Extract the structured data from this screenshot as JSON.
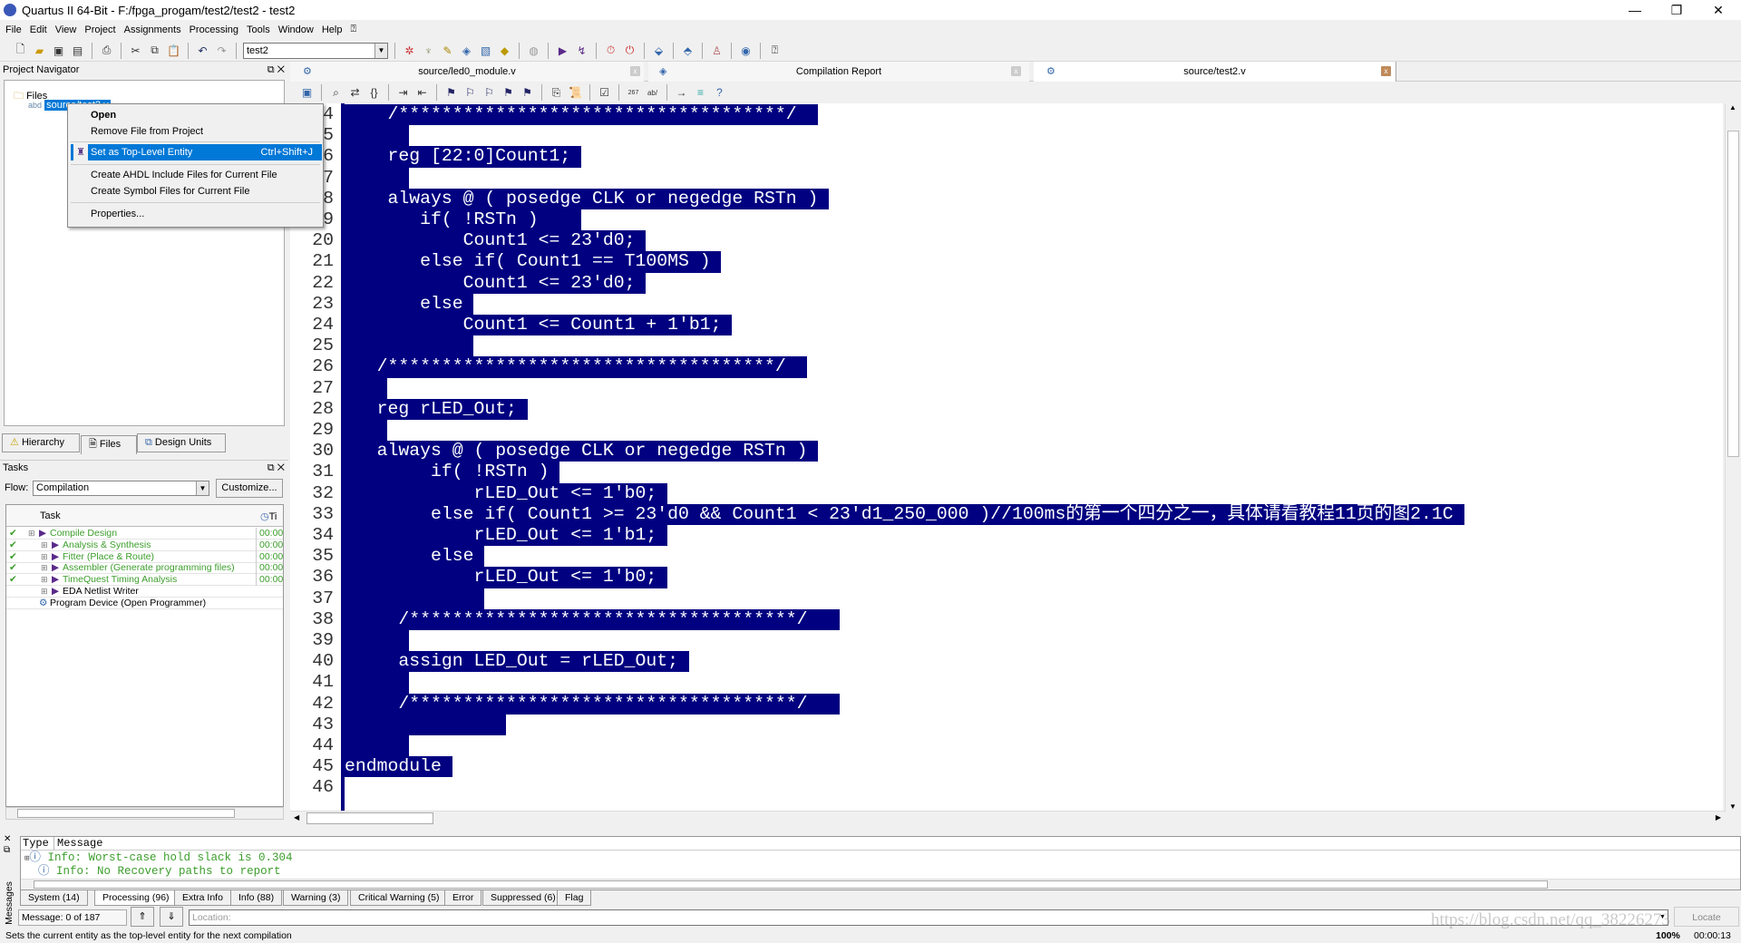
{
  "window": {
    "title": "Quartus II 64-Bit - F:/fpga_progam/test2/test2 - test2",
    "minimize": "—",
    "restore": "❐",
    "close": "✕"
  },
  "menu": [
    "File",
    "Edit",
    "View",
    "Project",
    "Assignments",
    "Processing",
    "Tools",
    "Window",
    "Help"
  ],
  "toolbar": {
    "project_select": "test2",
    "icons": [
      "new-file-icon",
      "open-icon",
      "save-icon",
      "save-all-icon",
      "print-icon",
      "cut-icon",
      "copy-icon",
      "paste-icon",
      "undo-icon",
      "redo-icon"
    ],
    "right_icons": [
      "compile-icon",
      "analysis-icon",
      "pencil-icon",
      "synthesis-icon",
      "fitter-icon",
      "assembler-icon",
      "netlist-icon",
      "start-icon",
      "timing-icon",
      "stopwatch-icon",
      "stop-icon",
      "chip-planner-icon",
      "rtl-viewer-icon",
      "programmer-icon",
      "help-icon",
      "whats-this-icon"
    ]
  },
  "navigator": {
    "title": "Project Navigator",
    "root": "Files",
    "file": "source/test2.v",
    "tabs": [
      "Hierarchy",
      "Files",
      "Design Units"
    ]
  },
  "context_menu": {
    "items": [
      "Open",
      "Remove File from Project",
      "Set as Top-Level Entity",
      "Create AHDL Include Files for Current File",
      "Create Symbol Files for Current File",
      "Properties..."
    ],
    "shortcut": "Ctrl+Shift+J"
  },
  "tasks": {
    "title": "Tasks",
    "flow_label": "Flow:",
    "flow_value": "Compilation",
    "customize": "Customize...",
    "col_task": "Task",
    "col_time": "Ti",
    "rows": [
      {
        "done": true,
        "name": "Compile Design",
        "time": "00:00",
        "level": 0
      },
      {
        "done": true,
        "name": "Analysis & Synthesis",
        "time": "00:00",
        "level": 1
      },
      {
        "done": true,
        "name": "Fitter (Place & Route)",
        "time": "00:00",
        "level": 1
      },
      {
        "done": true,
        "name": "Assembler (Generate programming files)",
        "time": "00:00",
        "level": 1
      },
      {
        "done": true,
        "name": "TimeQuest Timing Analysis",
        "time": "00:00",
        "level": 1
      },
      {
        "done": false,
        "name": "EDA Netlist Writer",
        "time": "",
        "level": 1
      },
      {
        "done": false,
        "name": "Program Device (Open Programmer)",
        "time": "",
        "level": 0
      }
    ]
  },
  "editor": {
    "tabs": [
      "source/led0_module.v",
      "Compilation Report",
      "source/test2.v"
    ],
    "first_line": 14,
    "lines": [
      "    /************************************/  ",
      "      ",
      "    reg [22:0]Count1; ",
      "      ",
      "    always @ ( posedge CLK or negedge RSTn ) ",
      "       if( !RSTn )    ",
      "           Count1 <= 23'd0; ",
      "       else if( Count1 == T100MS ) ",
      "           Count1 <= 23'd0; ",
      "       else ",
      "           Count1 <= Count1 + 1'b1; ",
      "            ",
      "   /************************************/  ",
      "    ",
      "   reg rLED_Out; ",
      "    ",
      "   always @ ( posedge CLK or negedge RSTn ) ",
      "        if( !RSTn ) ",
      "            rLED_Out <= 1'b0; ",
      "        else if( Count1 >= 23'd0 && Count1 < 23'd1_250_000 )//100ms的第一个四分之一，具体请看教程11页的图2.1C ",
      "            rLED_Out <= 1'b1; ",
      "        else ",
      "            rLED_Out <= 1'b0; ",
      "             ",
      "     /************************************/   ",
      "      ",
      "     assign LED_Out = rLED_Out; ",
      "      ",
      "     /************************************/   ",
      "               ",
      "      ",
      "endmodule ",
      ""
    ]
  },
  "messages": {
    "col_type": "Type",
    "col_message": "Message",
    "rows": [
      "Info: Worst-case hold slack is 0.304",
      "Info: No Recovery paths to report"
    ],
    "tabs": [
      "System (14)",
      "Processing (96)",
      "Extra Info",
      "Info (88)",
      "Warning (3)",
      "Critical Warning (5)",
      "Error",
      "Suppressed (6)",
      "Flag"
    ],
    "side_label": "Messages",
    "count": "Message: 0 of 187",
    "location_placeholder": "Location:",
    "locate": "Locate"
  },
  "status": {
    "text": "Sets the current entity as the top-level entity for the next compilation",
    "zoom": "100%",
    "time": "00:00:13"
  },
  "watermark": "https://blog.csdn.net/qq_38226273",
  "colors": {
    "selection": "#000080",
    "menu_highlight": "#0078d7",
    "task_done": "#3c9e2c"
  }
}
